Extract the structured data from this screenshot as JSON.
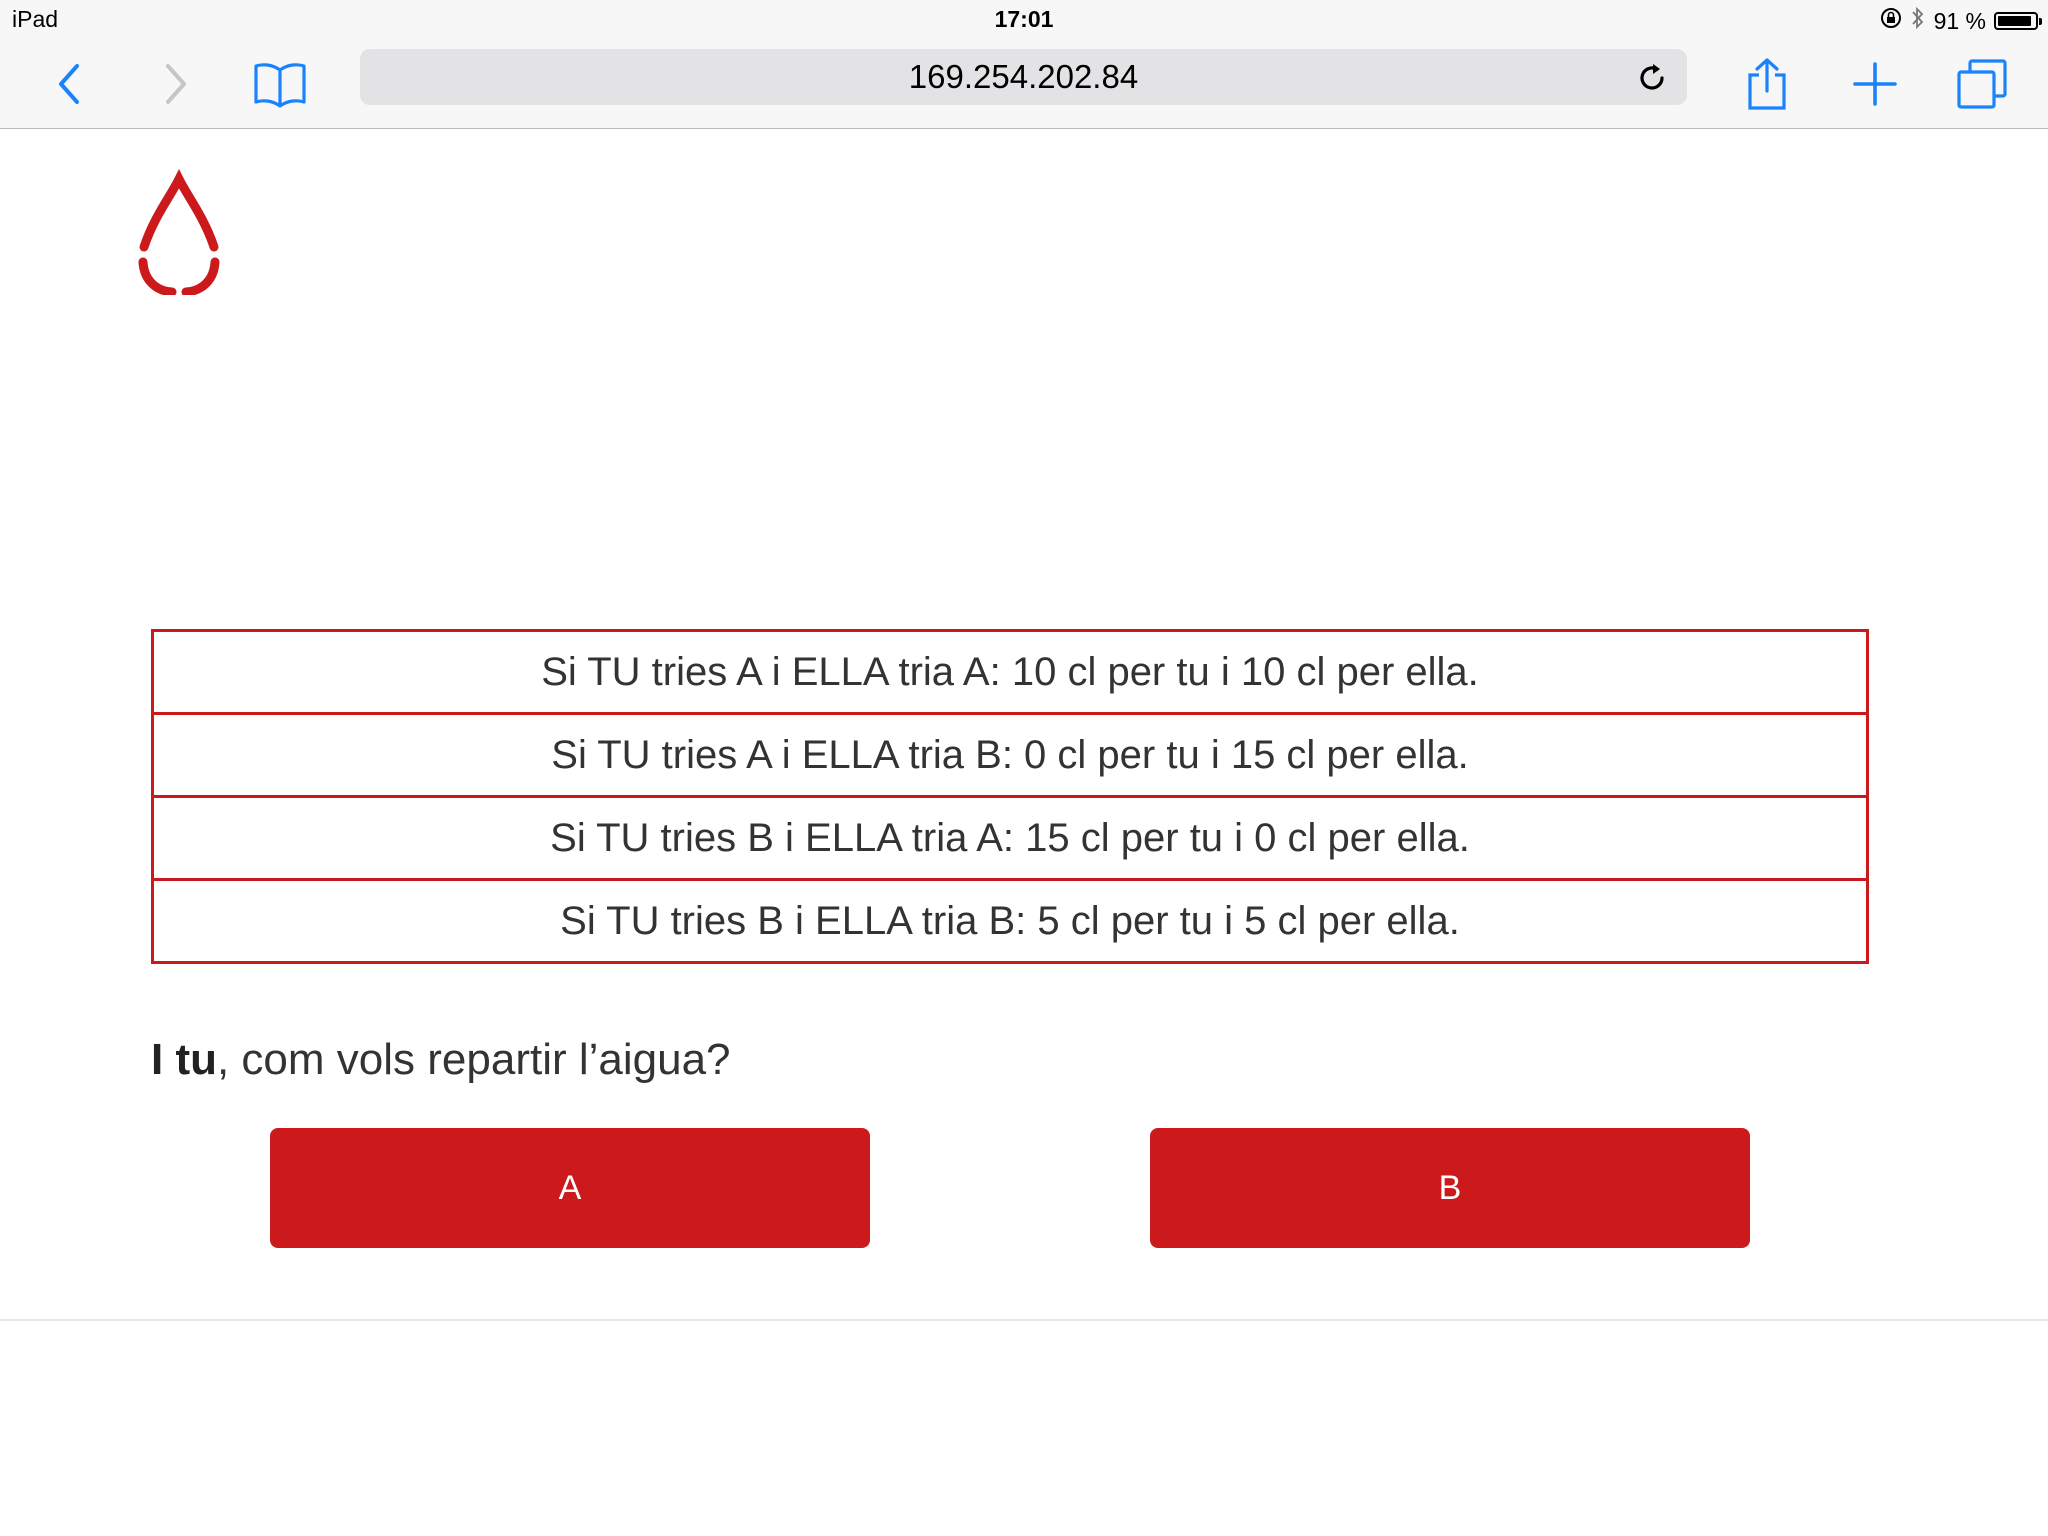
{
  "status_bar": {
    "device": "iPad",
    "time": "17:01",
    "battery": "91 %",
    "battery_level": 0.91
  },
  "toolbar": {
    "url": "169.254.202.84",
    "icons": [
      "back-icon",
      "forward-icon",
      "bookmarks-icon",
      "reload-icon",
      "share-icon",
      "new-tab-icon",
      "tabs-icon"
    ]
  },
  "colors": {
    "accent": "#cc191c",
    "ios_blue": "#1a82fb"
  },
  "payoff_rows": [
    "Si TU tries A i ELLA tria A: 10 cl per tu i 10 cl per ella.",
    "Si TU tries A i ELLA tria B: 0 cl per tu i 15 cl per ella.",
    "Si TU tries B i ELLA tria A: 15 cl per tu i 0 cl per ella.",
    "Si TU tries B i ELLA tria B: 5 cl per tu i 5 cl per ella."
  ],
  "question": {
    "bold": "I tu",
    "rest": ", com vols repartir l’aigua?"
  },
  "buttons": {
    "a_label": "A",
    "b_label": "B"
  }
}
